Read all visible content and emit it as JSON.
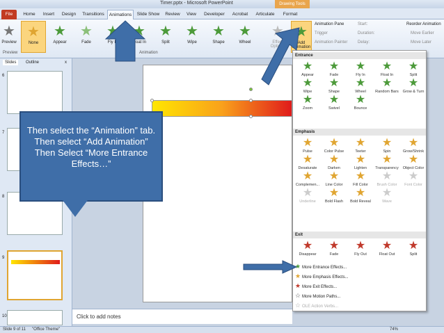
{
  "window": {
    "title": "Timer.pptx - Microsoft PowerPoint",
    "context_tab": "Drawing Tools"
  },
  "tabs": [
    "File",
    "Home",
    "Insert",
    "Design",
    "Transitions",
    "Animations",
    "Slide Show",
    "Review",
    "View",
    "Developer",
    "Acrobat",
    "Articulate",
    "Format"
  ],
  "ribbon": {
    "preview": "Preview",
    "effects": [
      {
        "label": "None",
        "color": "#e0a531"
      },
      {
        "label": "Appear",
        "color": "#4c9a3a"
      },
      {
        "label": "Fade",
        "color": "#4c9a3a"
      },
      {
        "label": "Fly In",
        "color": "#4c9a3a"
      },
      {
        "label": "Float In",
        "color": "#4c9a3a"
      },
      {
        "label": "Split",
        "color": "#4c9a3a"
      },
      {
        "label": "Wipe",
        "color": "#4c9a3a"
      },
      {
        "label": "Shape",
        "color": "#4c9a3a"
      },
      {
        "label": "Wheel",
        "color": "#4c9a3a"
      }
    ],
    "effect_options": "Effect Options",
    "add_animation": "Add Animation",
    "animation_pane": "Animation Pane",
    "trigger": "Trigger",
    "animation_painter": "Animation Painter",
    "start": "Start:",
    "duration": "Duration:",
    "delay": "Delay:",
    "reorder": "Reorder Animation",
    "move_earlier": "Move Earlier",
    "move_later": "Move Later",
    "group_preview": "Preview",
    "group_animation": "Animation"
  },
  "panel": {
    "tabs": [
      "Slides",
      "Outline"
    ],
    "close": "x",
    "slide_numbers": [
      "6",
      "7",
      "8",
      "9",
      "10"
    ]
  },
  "callout": {
    "text": "Then select the “Animation” tab. Then select “Add Animation” Then Select “More Entrance Effects…”"
  },
  "notes": {
    "placeholder": "Click to add notes"
  },
  "status": {
    "slide": "Slide 9 of 11",
    "theme": "\"Office Theme\"",
    "zoom": "74%"
  },
  "dropdown": {
    "entrance_title": "Entrance",
    "entrance": [
      "Appear",
      "Fade",
      "Fly In",
      "Float In",
      "Split",
      "Wipe",
      "Shape",
      "Wheel",
      "Random Bars",
      "Grow & Turn",
      "Zoom",
      "Swivel",
      "Bounce"
    ],
    "emphasis_title": "Emphasis",
    "emphasis": [
      "Pulse",
      "Color Pulse",
      "Teeter",
      "Spin",
      "Grow/Shrink",
      "Desaturate",
      "Darken",
      "Lighten",
      "Transparency",
      "Object Color",
      "Complemen...",
      "Line Color",
      "Fill Color",
      "Brush Color",
      "Font Color",
      "Underline",
      "Bold Flash",
      "Bold Reveal",
      "Wave"
    ],
    "exit_title": "Exit",
    "exit": [
      "Disappear",
      "Fade",
      "Fly Out",
      "Float Out",
      "Split"
    ],
    "menu": [
      "More Entrance Effects...",
      "More Emphasis Effects...",
      "More Exit Effects...",
      "More Motion Paths...",
      "OLE Action Verbs..."
    ]
  },
  "colors": {
    "accent": "#3f6ea8",
    "entrance": "#4c9a3a",
    "emphasis": "#e0a531",
    "exit": "#c0392b"
  }
}
